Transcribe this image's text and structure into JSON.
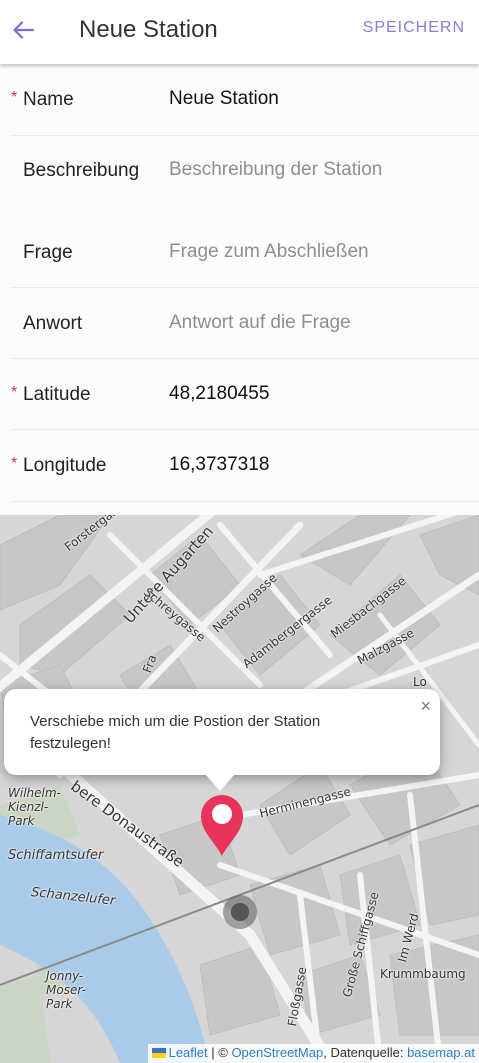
{
  "header": {
    "title": "Neue Station",
    "save_label": "SPEICHERN",
    "back_icon": "arrow-left-icon"
  },
  "form": {
    "name": {
      "label": "Name",
      "value": "Neue Station",
      "required": true
    },
    "description": {
      "label": "Beschreibung",
      "placeholder": "Beschreibung der Station"
    },
    "question": {
      "label": "Frage",
      "placeholder": "Frage zum Abschließen"
    },
    "answer": {
      "label": "Anwort",
      "placeholder": "Antwort auf die Frage"
    },
    "latitude": {
      "label": "Latitude",
      "value": "48,2180455",
      "required": true
    },
    "longitude": {
      "label": "Longitude",
      "value": "16,3737318",
      "required": true
    },
    "required_mark": "*"
  },
  "map": {
    "popup_text": "Verschiebe mich um die Postion der Station festzulegen!",
    "popup_close": "×",
    "marker_color": "#e8335a",
    "labels": {
      "forstergasse": "Forstergasse",
      "untere_augarten": "Untere Augarten",
      "schreygasse": "Schreygasse",
      "nestroygasse": "Nestroygasse",
      "adambergergasse": "Adambergergasse",
      "miesbachgasse": "Miesbachgasse",
      "malzgasse": "Malzgasse",
      "herminengasse": "Herminengasse",
      "donaustrasse": "bere Donaustraße",
      "wilhelm_kienzl_park": "Wilhelm-Kienzl-Park",
      "schiffamtsufer": "Schiffamtsufer",
      "schanzelufer": "Schanzelufer",
      "jonny_moser_park": "Jonny-Moser-Park",
      "fliessgasse": "Floßgasse",
      "grosse_schiffgasse": "Große Schiffgasse",
      "im_werd": "Im Werd",
      "krummbaumgasse": "Krummbaumg",
      "fra": "Fra",
      "lo": "Lo"
    },
    "attribution": {
      "leaflet": "Leaflet",
      "separator": " | © ",
      "osm": "OpenStreetMap",
      "source": ", Datenquelle: ",
      "basemap": "basemap.at"
    }
  }
}
